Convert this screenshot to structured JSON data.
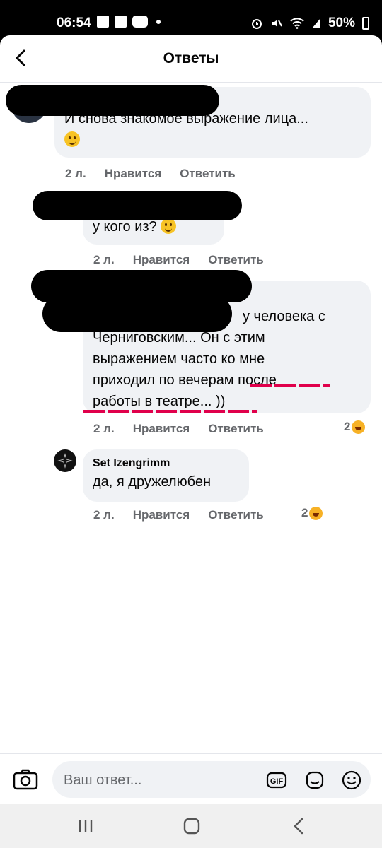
{
  "status_bar": {
    "time": "06:54",
    "battery": "50%"
  },
  "header": {
    "title": "Ответы",
    "back_icon": "arrow-left-icon"
  },
  "comments": [
    {
      "text": "И снова знакомое выражение лица...",
      "emoji": "winking-face",
      "meta": {
        "age": "2 л.",
        "like": "Нравится",
        "reply": "Ответить"
      }
    },
    {
      "text": "у кого из?",
      "emoji": "smiling-face",
      "meta": {
        "age": "2 л.",
        "like": "Нравится",
        "reply": "Ответить"
      }
    },
    {
      "text_line1": "у человека с",
      "text_line2": "Черниговским... Он с этим",
      "text_line3": "выражением часто ко мне",
      "text_line4": "приходил по вечерам после",
      "text_line5": "работы в театре... ))",
      "meta": {
        "age": "2 л.",
        "like": "Нравится",
        "reply": "Ответить"
      },
      "reactions": {
        "count": "2",
        "emoji": "laughing-face"
      }
    },
    {
      "author": "Set Izengrimm",
      "text": "да, я дружелюбен",
      "meta": {
        "age": "2 л.",
        "like": "Нравится",
        "reply": "Ответить"
      },
      "reactions": {
        "count": "2",
        "emoji": "laughing-face"
      }
    }
  ],
  "composer": {
    "placeholder": "Ваш ответ...",
    "gif_label": "GIF"
  },
  "colors": {
    "bubble": "#f0f2f5",
    "meta": "#65676b",
    "underline": "#e0004b"
  }
}
